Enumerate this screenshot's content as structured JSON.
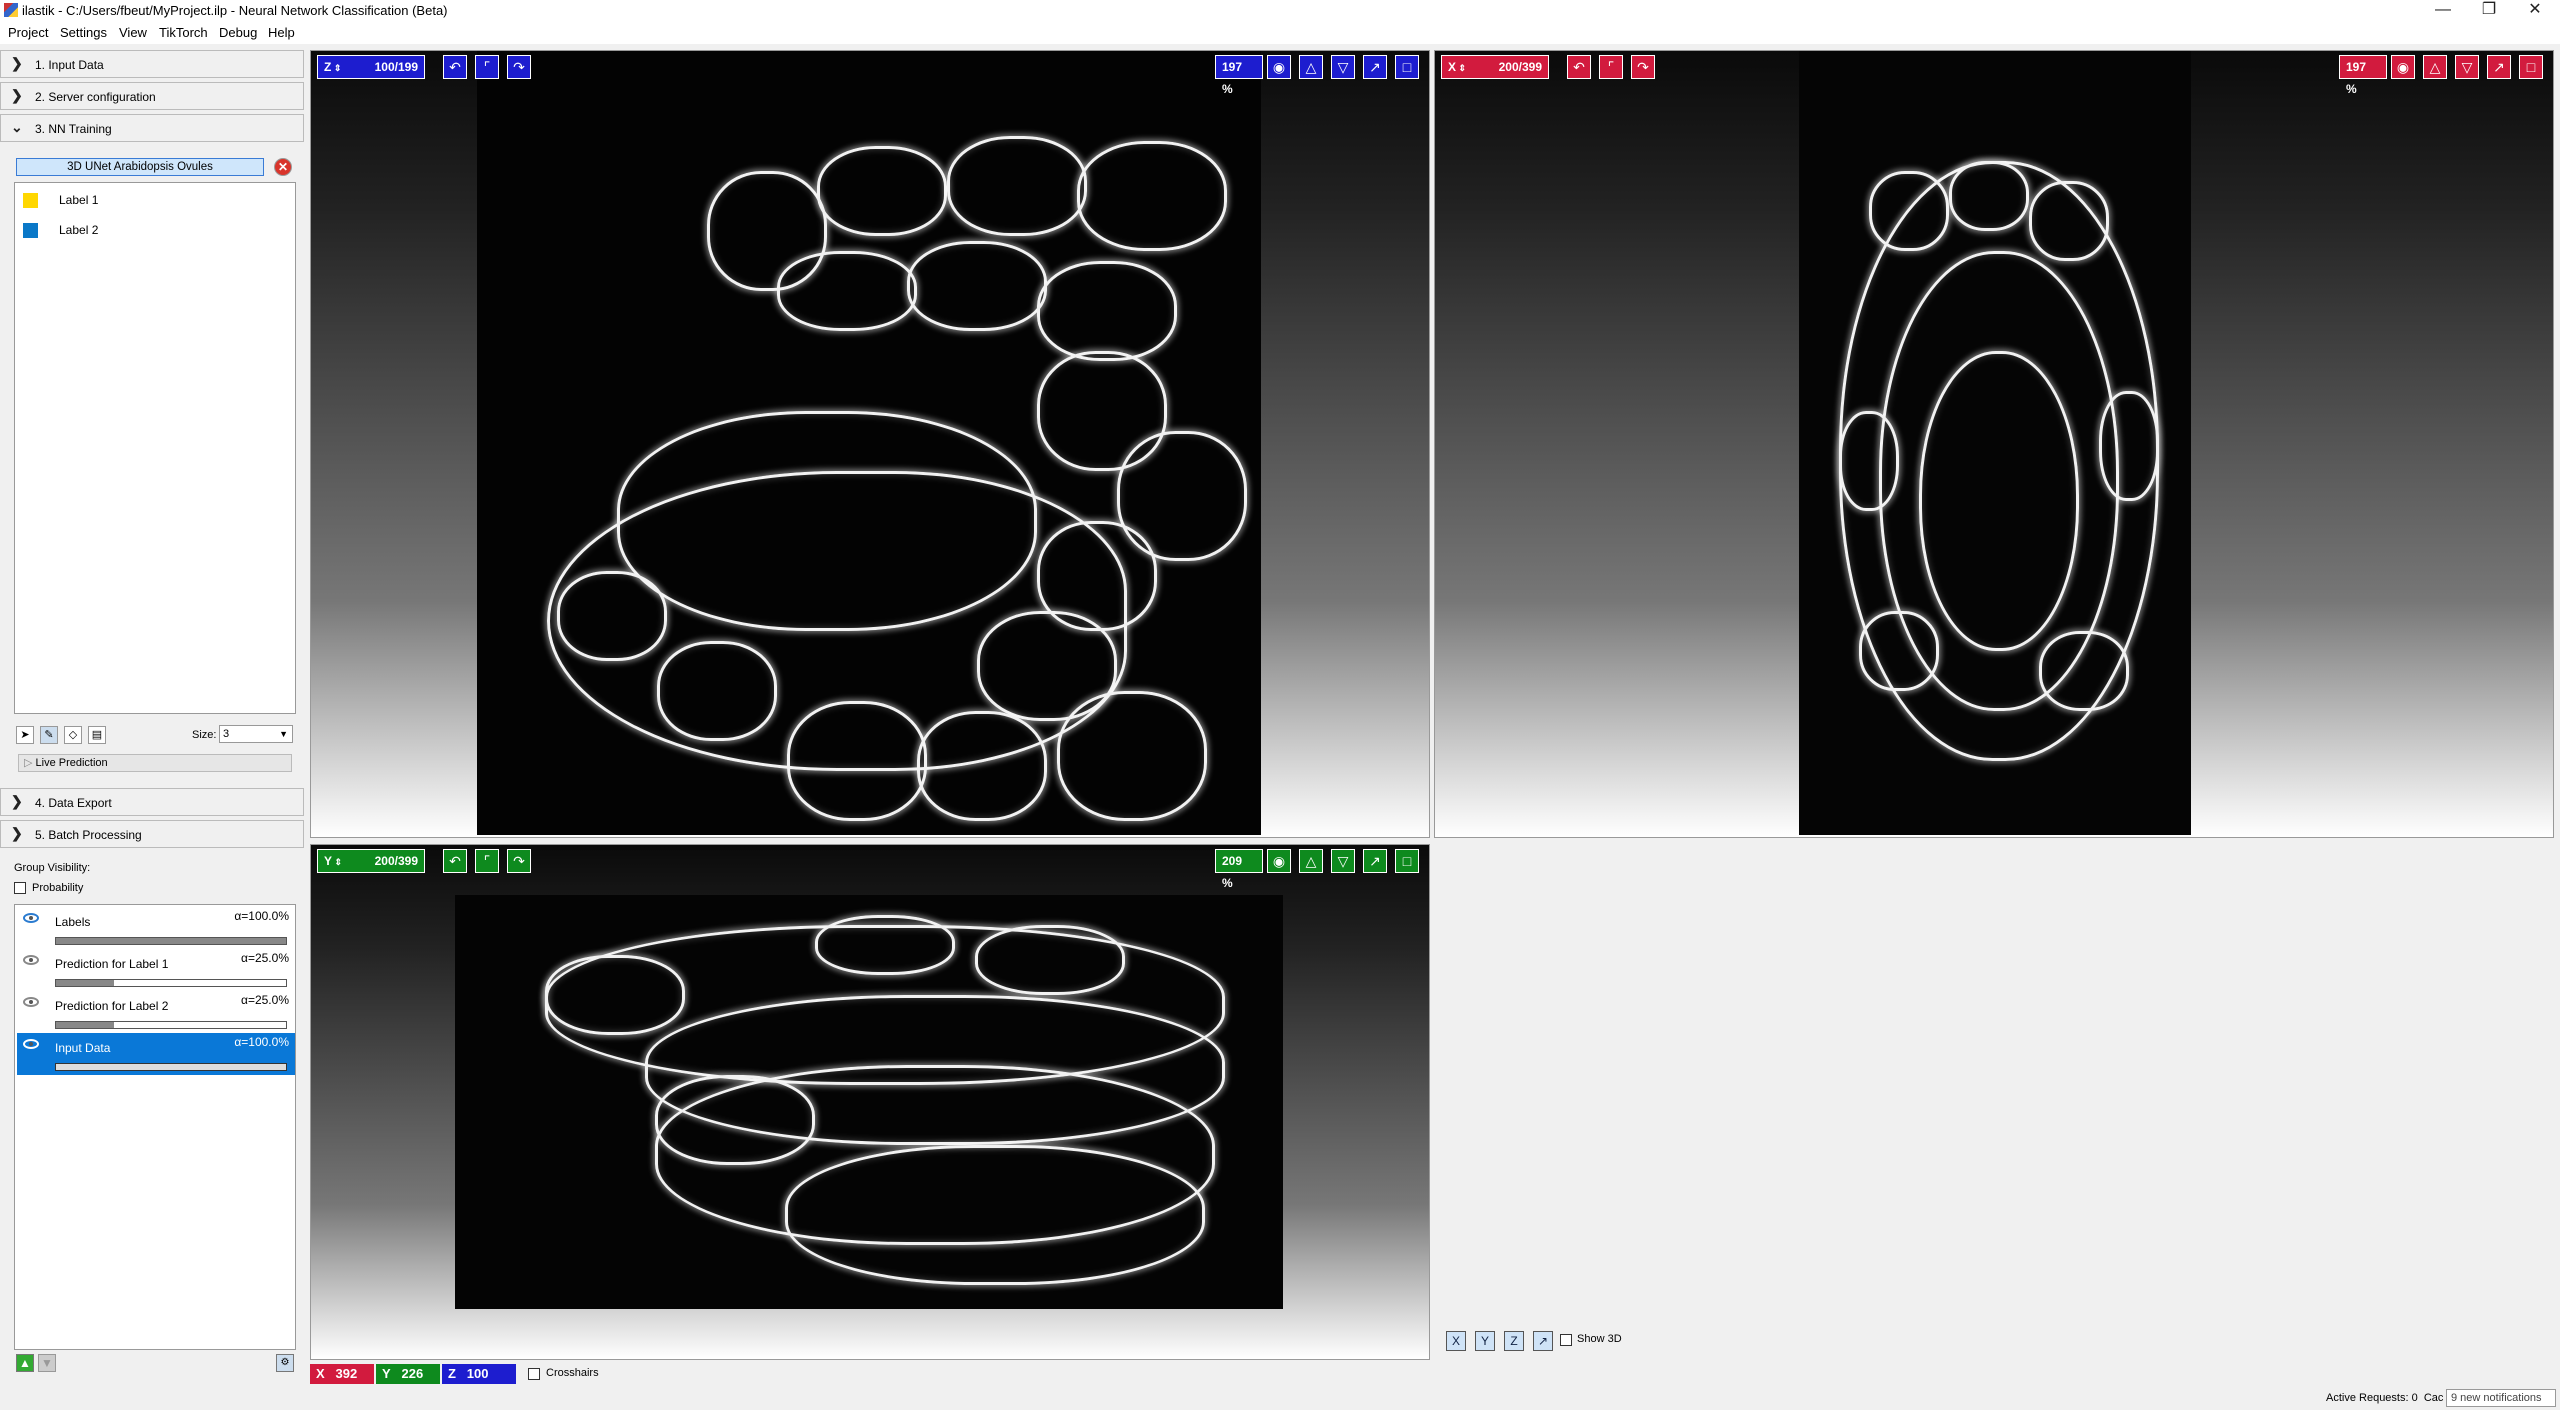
{
  "window": {
    "title": "ilastik - C:/Users/fbeut/MyProject.ilp - Neural Network Classification (Beta)",
    "controls": [
      "—",
      "❐",
      "✕"
    ]
  },
  "menu": [
    "Project",
    "Settings",
    "View",
    "TikTorch",
    "Debug",
    "Help"
  ],
  "applets": {
    "input_data": "1. Input Data",
    "server_config": "2. Server configuration",
    "nn_training": "3. NN Training",
    "data_export": "4. Data Export",
    "batch_processing": "5. Batch Processing"
  },
  "training": {
    "model_name": "3D UNet Arabidopsis Ovules",
    "labels": [
      {
        "name": "Label 1",
        "color": "#ffd700"
      },
      {
        "name": "Label 2",
        "color": "#0a78c8"
      }
    ],
    "size_label": "Size:",
    "size_value": "3",
    "live_prediction": "Live Prediction"
  },
  "layers": {
    "group_visibility": "Group Visibility:",
    "probability_label": "Probability",
    "items": [
      {
        "name": "Labels",
        "alpha": "α=100.0%",
        "opacity": 1.0,
        "selected": false
      },
      {
        "name": "Prediction for Label 1",
        "alpha": "α=25.0%",
        "opacity": 0.25,
        "selected": false
      },
      {
        "name": "Prediction for Label 2",
        "alpha": "α=25.0%",
        "opacity": 0.25,
        "selected": false
      },
      {
        "name": "Input Data",
        "alpha": "α=100.0%",
        "opacity": 1.0,
        "selected": true
      }
    ]
  },
  "viewers": {
    "z": {
      "axis": "Z",
      "slice": "100/199",
      "zoom": "197 %",
      "color": "#1d1dcf"
    },
    "x": {
      "axis": "X",
      "slice": "200/399",
      "zoom": "197 %",
      "color": "#d21b3e"
    },
    "y": {
      "axis": "Y",
      "slice": "200/399",
      "zoom": "209 %",
      "color": "#0e8a1e"
    }
  },
  "status": {
    "x_label": "X",
    "x_value": "392",
    "y_label": "Y",
    "y_value": "226",
    "z_label": "Z",
    "z_value": "100",
    "crosshairs": "Crosshairs",
    "show3d": "Show 3D",
    "active_requests": "Active Requests: 0",
    "cache_trunc": "Cac",
    "notifications": "9 new notifications"
  },
  "icons": {
    "axis_x_btn": "X",
    "axis_y_btn": "Y",
    "axis_z_btn": "Z"
  }
}
